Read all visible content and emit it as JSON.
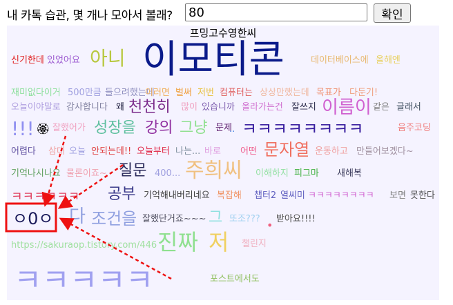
{
  "header": {
    "prompt_label": "내 카톡 습관, 몇 개나 모아서 볼래?",
    "count_value": "80",
    "confirm_label": "확인"
  },
  "cloud": {
    "title": "프밍고수영한씨",
    "words": [
      {
        "text": "신기한데",
        "color": "#e02020"
      },
      {
        "text": "있었어요",
        "color": "#9b59d0"
      },
      {
        "text": "아니",
        "color": "#b8c840"
      },
      {
        "text": "이모티콘",
        "color": "#0a1a8a"
      },
      {
        "text": "데이터베이스에",
        "color": "#e8b870"
      },
      {
        "text": "올해엔",
        "color": "#e8d060"
      },
      {
        "text": "재미없다이거",
        "color": "#90e0a0"
      },
      {
        "text": "500만큼",
        "color": "#a0a0e0"
      },
      {
        "text": "들으려했는데",
        "color": "#9090c0"
      },
      {
        "text": "이러면",
        "color": "#f0b060"
      },
      {
        "text": "벌써",
        "color": "#f0a040"
      },
      {
        "text": "저번",
        "color": "#e8c040"
      },
      {
        "text": "컴퓨터는",
        "color": "#e06060"
      },
      {
        "text": "상상만했는데",
        "color": "#f0b8a0"
      },
      {
        "text": "목표가",
        "color": "#f09070"
      },
      {
        "text": "다둔기!",
        "color": "#f0a080"
      },
      {
        "text": "오늘이야말로",
        "color": "#b0a0e0"
      },
      {
        "text": "감사합니다",
        "color": "#8080a0"
      },
      {
        "text": "왜",
        "color": "#202040"
      },
      {
        "text": "천천히",
        "color": "#7a2a8a"
      },
      {
        "text": "많이",
        "color": "#f0a0c0"
      },
      {
        "text": "있습니까",
        "color": "#8060b0"
      },
      {
        "text": "올라가는건",
        "color": "#d070d0"
      },
      {
        "text": "잘쓰지",
        "color": "#2a2a4a"
      },
      {
        "text": "이름이",
        "color": "#d060d0"
      },
      {
        "text": "같은",
        "color": "#808080"
      },
      {
        "text": "글래서",
        "color": "#405060"
      },
      {
        "text": "!!!",
        "color": "#9090f0"
      },
      {
        "text": "잘했어가",
        "color": "#f0a0c0"
      },
      {
        "text": "성장을",
        "color": "#60c0a0"
      },
      {
        "text": "강의",
        "color": "#9030a0"
      },
      {
        "text": "그냥",
        "color": "#90e090"
      },
      {
        "text": "문제",
        "color": "#602070"
      },
      {
        "text": "..",
        "color": "#4080e0"
      },
      {
        "text": "ㅋㅋㅋㅋㅋㅋㅋㅋ",
        "color": "#3a20a0"
      },
      {
        "text": "음주코딩",
        "color": "#f08080"
      },
      {
        "text": "어렵다",
        "color": "#6050a0"
      },
      {
        "text": "삼대",
        "color": "#f0a0a0"
      },
      {
        "text": "오늘",
        "color": "#a0a0e0"
      },
      {
        "text": "안되는데!!",
        "color": "#e04040"
      },
      {
        "text": "오늘부터",
        "color": "#e02040"
      },
      {
        "text": "나는...",
        "color": "#8090a0"
      },
      {
        "text": "바로",
        "color": "#e0a0e0"
      },
      {
        "text": "어떤",
        "color": "#f06090"
      },
      {
        "text": "문자열",
        "color": "#f07060"
      },
      {
        "text": "운동하고",
        "color": "#f0a0a0"
      },
      {
        "text": "만들어보겠다~",
        "color": "#a090a0"
      },
      {
        "text": "기억나시나요",
        "color": "#60a060"
      },
      {
        "text": "물론이죠~",
        "color": "#f0a0b0"
      },
      {
        "text": "질문",
        "color": "#2a2a5a"
      },
      {
        "text": "400...",
        "color": "#a0a0e0"
      },
      {
        "text": "주희씨",
        "color": "#f0c080"
      },
      {
        "text": "이해하지",
        "color": "#90e0a0"
      },
      {
        "text": "피그마",
        "color": "#40b040"
      },
      {
        "text": "새해복",
        "color": "#404060"
      },
      {
        "text": "ㅋㅋㅋㅋㅋㅋ",
        "color": "#e04060"
      },
      {
        "text": "공부",
        "color": "#3a3a8a"
      },
      {
        "text": "기억해내버리네요",
        "color": "#404040"
      },
      {
        "text": "복잡해",
        "color": "#f09060"
      },
      {
        "text": "챕터2",
        "color": "#6060c0"
      },
      {
        "text": "열씨미",
        "color": "#6060c0"
      },
      {
        "text": "ㅋㅋㅋㅋㅋㅋㅋㅋ",
        "color": "#d060d0"
      },
      {
        "text": "보면",
        "color": "#808080"
      },
      {
        "text": "못한다",
        "color": "#505050"
      },
      {
        "text": "ㅇ0ㅇ",
        "color": "#1a1a5a"
      },
      {
        "text": "다",
        "color": "#90a0e0"
      },
      {
        "text": "조건을",
        "color": "#90a0e0"
      },
      {
        "text": "잘했단거죠~~~",
        "color": "#505060"
      },
      {
        "text": "그",
        "color": "#90e0e0"
      },
      {
        "text": "또조???",
        "color": "#a0d0f0"
      },
      {
        "text": "받아요!!!!",
        "color": "#505050"
      },
      {
        "text": "https://sakuraop.tistory.com/446",
        "color": "#a0e0a0"
      },
      {
        "text": "진짜",
        "color": "#90e090"
      },
      {
        "text": "저",
        "color": "#f0d060"
      },
      {
        "text": "챌린지",
        "color": "#f0b0c0"
      },
      {
        "text": "ㅋㅋㅋㅋㅋ",
        "color": "#a0a0f0"
      },
      {
        "text": "포스트에서도",
        "color": "#90c060"
      }
    ]
  },
  "annotation": {
    "highlight_color": "#ee1111"
  }
}
